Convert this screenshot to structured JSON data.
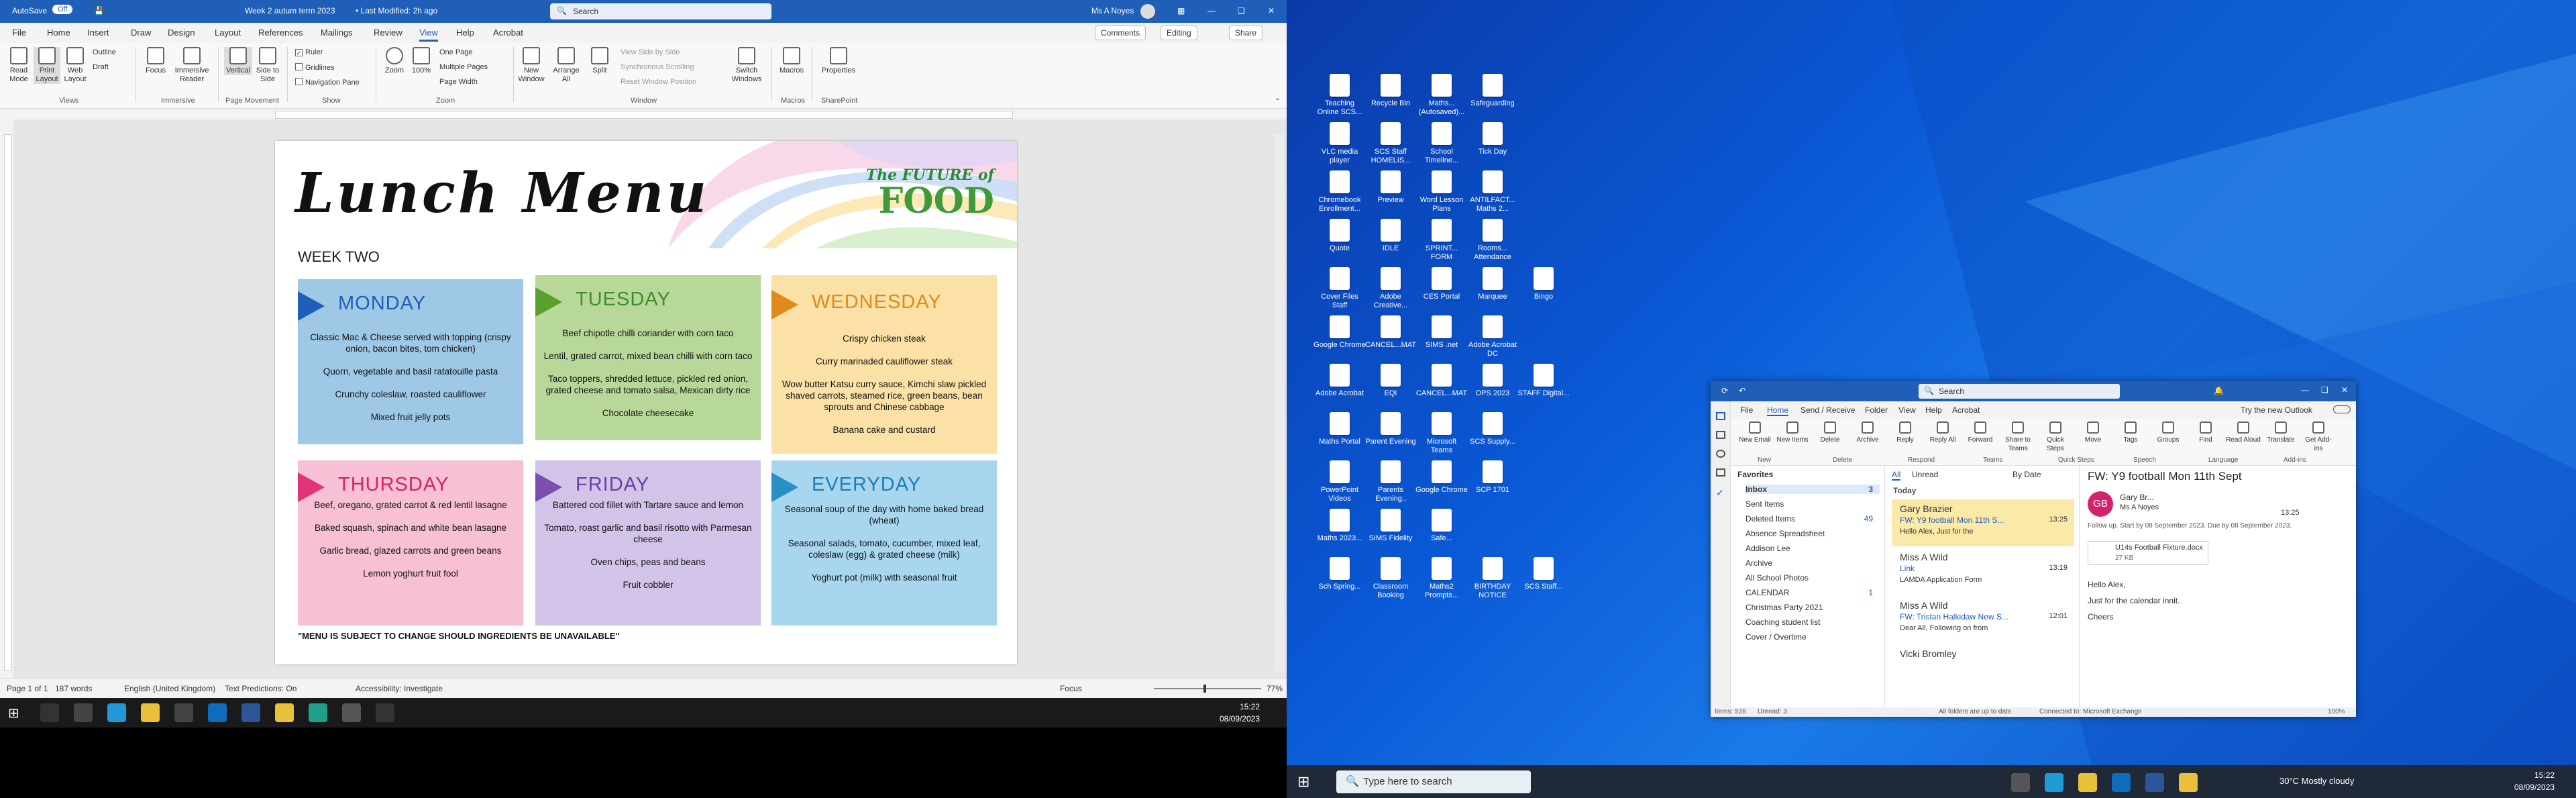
{
  "word": {
    "title": {
      "autosave": "AutoSave",
      "toggle": "Off",
      "doc": "Week 2 autum term 2023",
      "modified": "• Last Modified: 2h ago",
      "search": "Search",
      "user": "Ms A Noyes"
    },
    "tabs": [
      "File",
      "Home",
      "Insert",
      "Draw",
      "Design",
      "Layout",
      "References",
      "Mailings",
      "Review",
      "View",
      "Help",
      "Acrobat"
    ],
    "right_buttons": {
      "comments": "Comments",
      "editing": "Editing",
      "share": "Share"
    },
    "ribbon": {
      "views": [
        "Read Mode",
        "Print Layout",
        "Web Layout"
      ],
      "views_small": [
        "Outline",
        "Draft"
      ],
      "immersive": [
        "Focus",
        "Immersive Reader"
      ],
      "page_movement": [
        "Vertical",
        "Side to Side"
      ],
      "show": [
        "Ruler",
        "Gridlines",
        "Navigation Pane"
      ],
      "zoom": [
        "Zoom",
        "100%"
      ],
      "zoom_small": [
        "One Page",
        "Multiple Pages",
        "Page Width"
      ],
      "window": [
        "New Window",
        "Arrange All",
        "Split"
      ],
      "window_small": [
        "View Side by Side",
        "Synchronous Scrolling",
        "Reset Window Position"
      ],
      "switch": "Switch Windows",
      "macros": "Macros",
      "properties": "Properties",
      "groups": [
        "Views",
        "Immersive",
        "Page Movement",
        "Show",
        "Zoom",
        "Window",
        "Macros",
        "SharePoint"
      ]
    },
    "doc": {
      "title": "Lunch Menu",
      "logo_a": "The FUTURE of",
      "logo_b": "FOOD",
      "week": "WEEK TWO",
      "footer": "\"MENU IS SUBJECT TO CHANGE SHOULD INGREDIENTS BE UNAVAILABLE\"",
      "days": [
        {
          "name": "MONDAY",
          "items": [
            "Classic Mac & Cheese served with topping (crispy onion, bacon bites, tom chicken)",
            "Quorn, vegetable and basil ratatouille pasta",
            "Crunchy coleslaw, roasted cauliflower",
            "Mixed fruit jelly pots"
          ]
        },
        {
          "name": "TUESDAY",
          "items": [
            "Beef chipotle chilli coriander with corn taco",
            "Lentil, grated carrot, mixed bean chilli with corn taco",
            "Taco toppers, shredded lettuce, pickled red onion, grated cheese and tomato salsa, Mexican dirty rice",
            "Chocolate cheesecake"
          ]
        },
        {
          "name": "WEDNESDAY",
          "items": [
            "Crispy chicken steak",
            "Curry marinaded cauliflower steak",
            "Wow butter Katsu curry sauce, Kimchi slaw pickled shaved carrots, steamed rice, green beans, bean sprouts and Chinese cabbage",
            "Banana cake and custard"
          ]
        },
        {
          "name": "THURSDAY",
          "items": [
            "Beef, oregano, grated carrot & red lentil lasagne",
            "Baked squash, spinach and white bean lasagne",
            "Garlic bread, glazed carrots and green beans",
            "Lemon yoghurt fruit fool"
          ]
        },
        {
          "name": "FRIDAY",
          "items": [
            "Battered cod fillet with Tartare sauce and lemon",
            "Tomato, roast garlic and basil risotto with Parmesan cheese",
            "Oven chips, peas and beans",
            "Fruit cobbler"
          ]
        },
        {
          "name": "EVERYDAY",
          "items": [
            "Seasonal soup of the day with home baked bread (wheat)",
            "Seasonal salads, tomato, cucumber, mixed leaf, coleslaw (egg) & grated cheese (milk)",
            "Yoghurt pot (milk) with seasonal fruit"
          ]
        }
      ]
    },
    "status": {
      "page": "Page 1 of 1",
      "words": "187 words",
      "lang": "English (United Kingdom)",
      "predict": "Text Predictions: On",
      "access": "Accessibility: Investigate",
      "focus": "Focus",
      "zoom": "77%"
    }
  },
  "colors": {
    "monday": "#9ec8e6",
    "tuesday": "#b8d89a",
    "wednesday": "#fbe1a5",
    "thursday": "#f7c0d4",
    "friday": "#d2c3e8",
    "everyday": "#a9d6ef",
    "word_blue": "#1f5fb8"
  },
  "taskbar1": {
    "time": "15:22",
    "date": "08/09/2023"
  },
  "desktop": {
    "icons": [
      "Teaching Online SCS...",
      "Recycle Bin",
      "Maths... (Autosaved)...",
      "Safeguarding",
      "VLC media player",
      "SCS Staff HOMELIS...",
      "School Timeline...",
      "Tick Day",
      "Chromebook Enrollment...",
      "Preview",
      "Word Lesson Plans",
      "ANTILFACT... Maths 2...",
      "Quote",
      "IDLE",
      "SPRINT... FORM",
      "Rooms... Attendance",
      "Cover Files Staff",
      "Adobe Creative...",
      "CES Portal",
      "Marquee",
      "Bingo",
      "Google Chrome",
      "CANCEL...MAT",
      "SIMS .net",
      "Adobe Acrobat DC",
      "Adobe Acrobat",
      "EQI",
      "CANCEL...MAT",
      "OPS 2023",
      "STAFF Digital...",
      "Maths Portal",
      "Parent Evening",
      "Microsoft Teams",
      "SCS Supply...",
      "PowerPoint Videos",
      "Parents Evening..",
      "Google Chrome",
      "SCP 1701",
      "Maths 2023...",
      "SIMS Fidelity",
      "Safe...",
      "Sch Spring...",
      "Classroom Booking",
      "Maths2 Prompts...",
      "BIRTHDAY NOTICE",
      "SCS Staff..."
    ]
  },
  "outlook": {
    "title": {
      "search": "Search"
    },
    "tabs": [
      "File",
      "Home",
      "Send / Receive",
      "Folder",
      "View",
      "Help",
      "Acrobat"
    ],
    "try": "Try the new Outlook",
    "ribbon": [
      "New Email",
      "New Items",
      "Delete",
      "Archive",
      "Reply",
      "Reply All",
      "Forward",
      "Share to Teams",
      "Quick Steps",
      "Move",
      "Tags",
      "Groups",
      "Find",
      "Read Aloud",
      "Translate",
      "Get Add-ins"
    ],
    "ribbon_groups": [
      "New",
      "Delete",
      "Respond",
      "Teams",
      "Quick Steps",
      "Speech",
      "Language",
      "Add-ins"
    ],
    "folders": {
      "header": "Favorites",
      "items": [
        {
          "name": "Inbox",
          "count": "3"
        },
        {
          "name": "Sent Items",
          "count": ""
        },
        {
          "name": "Deleted Items",
          "count": "49"
        },
        {
          "name": "Absence Spreadsheet",
          "count": ""
        },
        {
          "name": "Addison Lee",
          "count": ""
        },
        {
          "name": "Archive",
          "count": ""
        },
        {
          "name": "All School Photos",
          "count": ""
        },
        {
          "name": "CALENDAR",
          "count": "1"
        },
        {
          "name": "Christmas Party 2021",
          "count": ""
        },
        {
          "name": "Coaching student list",
          "count": ""
        },
        {
          "name": "Cover / Overtime",
          "count": ""
        }
      ]
    },
    "list": {
      "tabs": [
        "All",
        "Unread"
      ],
      "sort": "By Date",
      "group": "Today",
      "items": [
        {
          "from": "Gary Brazier",
          "subject": "FW: Y9 football Mon 11th S...",
          "preview": "Hello Alex, Just for the",
          "time": "13:25"
        },
        {
          "from": "Miss A Wild",
          "subject": "Link",
          "preview": "LAMDA Application Form",
          "time": "13:19"
        },
        {
          "from": "Miss A Wild",
          "subject": "FW: Tristan Halkidaw New S...",
          "preview": "Dear All, Following on from",
          "time": "12:01"
        },
        {
          "from": "Vicki Bromley",
          "subject": "",
          "preview": "",
          "time": ""
        }
      ]
    },
    "read": {
      "subject": "FW: Y9 football Mon 11th Sept",
      "from": "Gary Br...",
      "to": "Ms A Noyes",
      "time": "13:25",
      "follow": "Follow up. Start by 08 September 2023. Due by 08 September 2023.",
      "attach": "U14s Football Fixture.docx",
      "attach_size": "27 KB",
      "body": [
        "Hello Alex,",
        "Just for the calendar innit.",
        "Cheers"
      ]
    },
    "status": {
      "items": "Items: 528",
      "unread": "Unread: 3",
      "sync": "All folders are up to date.",
      "conn": "Connected to: Microsoft Exchange",
      "zoom": "100%"
    }
  },
  "taskbar2": {
    "search": "Type here to search",
    "weather": "30°C  Mostly cloudy",
    "time": "15:22",
    "date": "08/09/2023"
  }
}
